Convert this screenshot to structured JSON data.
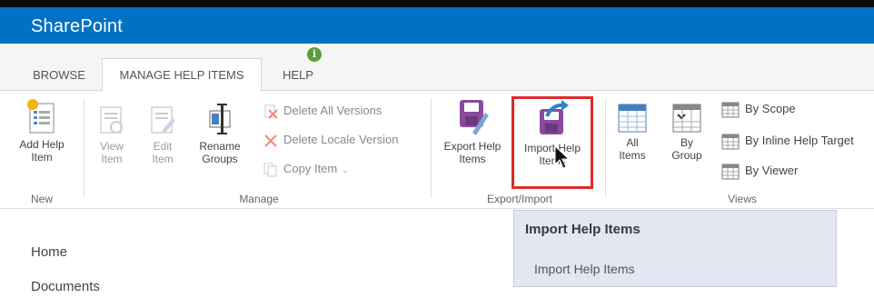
{
  "app": {
    "brand": "SharePoint"
  },
  "tabs": [
    {
      "label": "BROWSE",
      "active": false
    },
    {
      "label": "MANAGE HELP ITEMS",
      "active": true
    },
    {
      "label": "HELP",
      "active": false
    }
  ],
  "ribbon": {
    "new": {
      "group_label": "New",
      "add_help_item": "Add Help Item"
    },
    "manage": {
      "group_label": "Manage",
      "view_item": "View Item",
      "edit_item": "Edit Item",
      "rename_groups": "Rename Groups",
      "delete_all_versions": "Delete All Versions",
      "delete_locale_version": "Delete Locale Version",
      "copy_item": "Copy Item"
    },
    "export_import": {
      "group_label": "Export/Import",
      "export_help_items": "Export Help Items",
      "import_help_items": "Import Help Items"
    },
    "views": {
      "group_label": "Views",
      "all_items": "All Items",
      "by_group": "By Group",
      "by_scope": "By Scope",
      "by_inline_help_target": "By Inline Help Target",
      "by_viewer": "By Viewer"
    }
  },
  "tooltip": {
    "title": "Import Help Items",
    "body": "Import Help Items"
  },
  "quick_launch": [
    "Home",
    "Documents"
  ],
  "colors": {
    "suite_bar": "#0072c6",
    "highlight": "#e02a2a",
    "tooltip_bg": "#e4e6f2"
  }
}
